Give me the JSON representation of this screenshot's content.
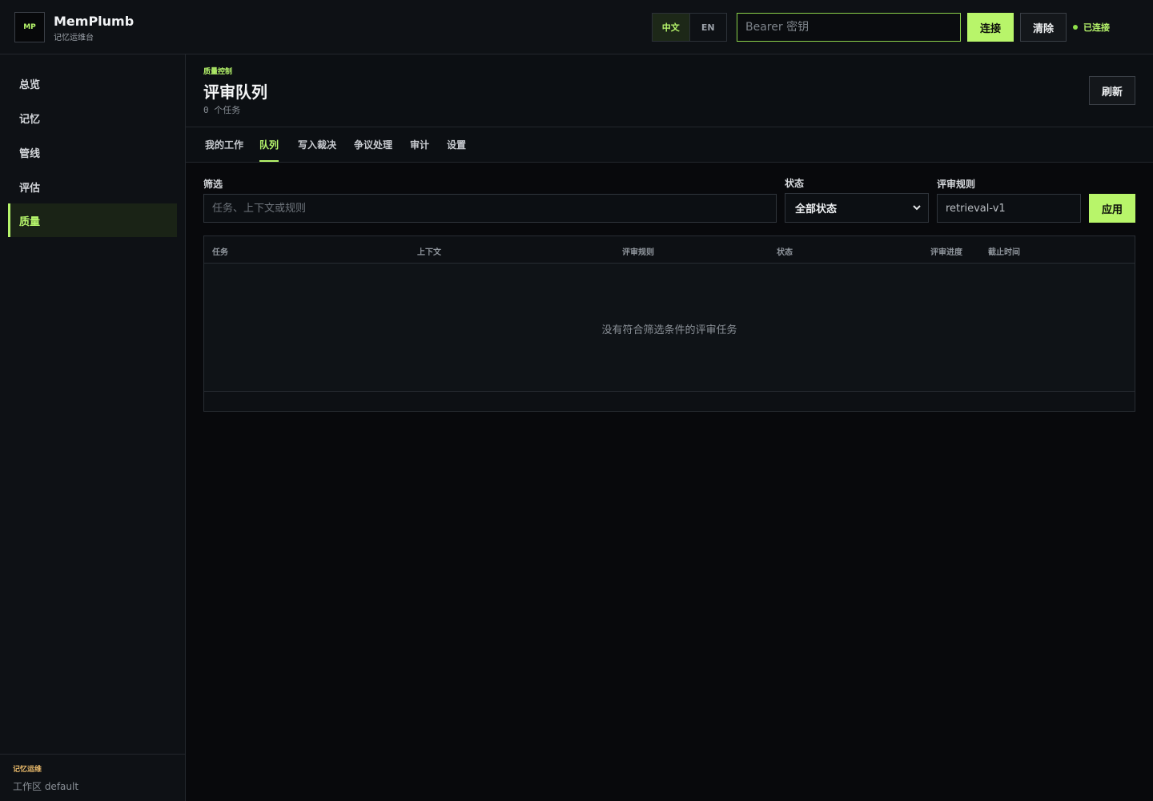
{
  "app": {
    "logo": "MP",
    "title": "MemPlumb",
    "subtitle": "记忆运维台"
  },
  "header": {
    "lang_options": [
      "中文",
      "EN"
    ],
    "active_lang": "中文",
    "token_placeholder": "Bearer 密钥",
    "token_value": "",
    "connect_label": "连接",
    "clear_label": "清除",
    "status_text": "已连接",
    "status_color": "#8fe04a"
  },
  "sidebar": {
    "items": [
      {
        "label": "总览"
      },
      {
        "label": "记忆"
      },
      {
        "label": "管线"
      },
      {
        "label": "评估"
      },
      {
        "label": "质量"
      }
    ],
    "active_index": 4,
    "footer_kicker": "记忆运维",
    "footer_workspace": "工作区 default"
  },
  "page": {
    "kicker": "质量控制",
    "title": "评审队列",
    "count_text": "0 个任务",
    "refresh_label": "刷新"
  },
  "tabs": [
    {
      "label": "我的工作"
    },
    {
      "label": "队列"
    },
    {
      "label": "写入裁决"
    },
    {
      "label": "争议处理"
    },
    {
      "label": "审计"
    },
    {
      "label": "设置"
    }
  ],
  "active_tab_index": 1,
  "filters": {
    "filter_label": "筛选",
    "filter_placeholder": "任务、上下文或规则",
    "status_label": "状态",
    "status_value": "全部状态",
    "rubric_label": "评审规则",
    "rubric_value": "retrieval-v1",
    "apply_label": "应用"
  },
  "table": {
    "columns": [
      "任务",
      "上下文",
      "评审规则",
      "状态",
      "评审进度",
      "截止时间"
    ],
    "rows": [],
    "empty_text": "没有符合筛选条件的评审任务"
  },
  "colors": {
    "accent": "#b6f56b",
    "background": "#08090c",
    "panel": "#0e1115"
  }
}
